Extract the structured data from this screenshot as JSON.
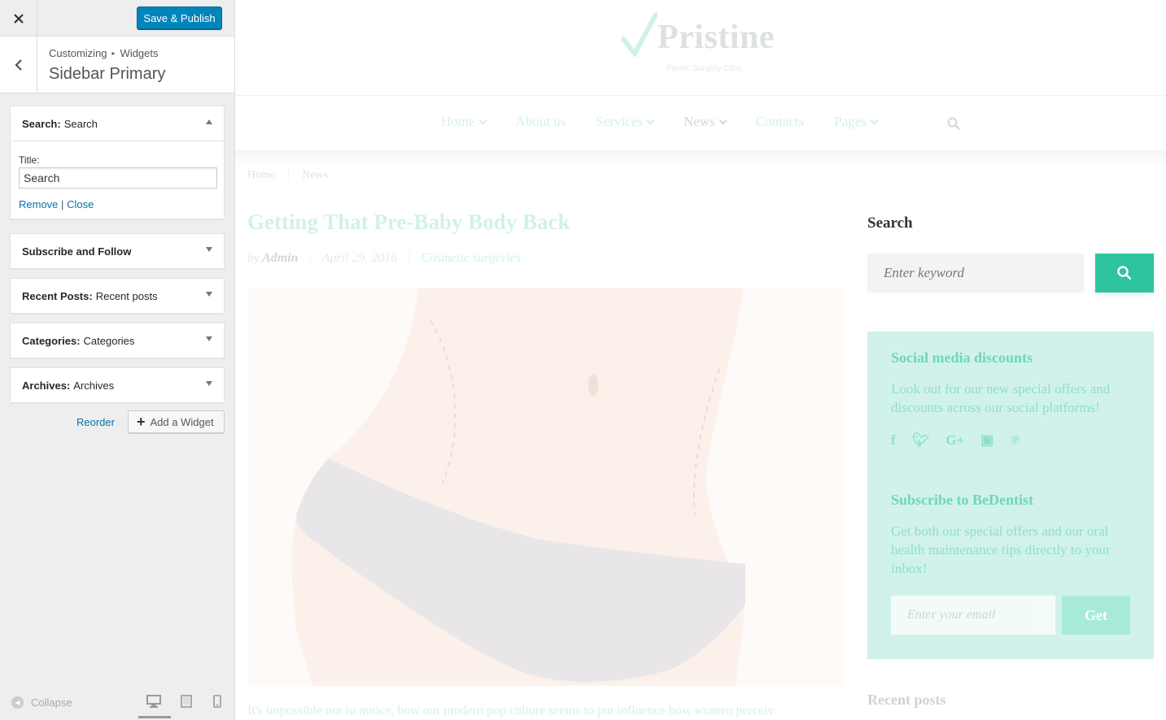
{
  "customizer": {
    "publish_label": "Save & Publish",
    "breadcrumb": {
      "root": "Customizing",
      "section": "Widgets"
    },
    "section_title": "Sidebar Primary",
    "widgets": [
      {
        "type": "Search:",
        "title": "Search",
        "expanded": true
      },
      {
        "type": "Subscribe and Follow",
        "title": "",
        "expanded": false
      },
      {
        "type": "Recent Posts:",
        "title": "Recent posts",
        "expanded": false
      },
      {
        "type": "Categories:",
        "title": "Categories",
        "expanded": false
      },
      {
        "type": "Archives:",
        "title": "Archives",
        "expanded": false
      }
    ],
    "search_form": {
      "title_label": "Title:",
      "title_value": "Search",
      "remove": "Remove",
      "separator": "|",
      "close": "Close"
    },
    "reorder_label": "Reorder",
    "add_widget_label": "Add a Widget",
    "collapse_label": "Collapse"
  },
  "site": {
    "logo": "Pristine",
    "tagline": "Plastic Surgery Clinic",
    "nav": [
      "Home",
      "About us",
      "Services",
      "News",
      "Contacts",
      "Pages"
    ],
    "breadcrumb": [
      "Home",
      "News"
    ],
    "post": {
      "title": "Getting That Pre-Baby Body Back",
      "by": "by",
      "author": "Admin",
      "date": "April 29, 2016",
      "category": "Cosmetic surgeries",
      "excerpt": "It's impossible not to notice, how our modern pop culture seems to put influence how women perceiv"
    },
    "sidebar": {
      "search_title": "Search",
      "search_placeholder": "Enter keyword",
      "promo_title": "Social media discounts",
      "promo_text": "Look out for our new special offers and discounts across our social platforms!",
      "subscribe_title": "Subscribe to BeDentist",
      "subscribe_text": "Get both our special offers and our oral health maintenance tips directly to your inbox!",
      "email_placeholder": "Enter your email",
      "get_label": "Get",
      "recent_title": "Recent posts"
    },
    "colors": {
      "accent": "#2ec4a0",
      "wp_blue": "#0085ba"
    }
  }
}
